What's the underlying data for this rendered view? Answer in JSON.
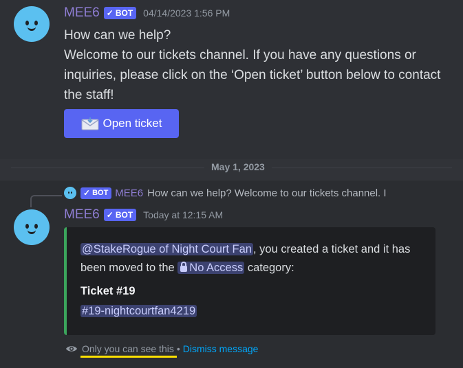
{
  "message1": {
    "username": "MEE6",
    "badge": "BOT",
    "timestamp": "04/14/2023 1:56 PM",
    "lines": [
      "How can we help?",
      "Welcome to our tickets channel. If you have any questions or inquiries, please click on the ‘Open ticket’ button below to contact the staff!"
    ],
    "button_label": "Open ticket"
  },
  "divider": {
    "label": "May 1, 2023"
  },
  "message2": {
    "reply": {
      "badge": "BOT",
      "username": "MEE6",
      "text": "How can we help? Welcome to our tickets channel. I"
    },
    "username": "MEE6",
    "badge": "BOT",
    "timestamp": "Today at 12:15 AM",
    "embed": {
      "user_mention": "@StakeRogue of Night Court Fan",
      "text_part1": ", you created a ticket and it has been moved to the",
      "category_mention": "No Access",
      "text_part2": " category:",
      "ticket_title": "Ticket #19",
      "channel_mention": "#19-nightcourtfan4219",
      "accent_color": "#3ba55c"
    },
    "ephemeral": {
      "notice": "Only you can see this",
      "separator": "•",
      "dismiss": "Dismiss message"
    }
  },
  "colors": {
    "background": "#313338",
    "blurple": "#5865f2",
    "username": "#8f7ed4",
    "link": "#00a8fc",
    "highlight_underline": "#ffe100"
  }
}
